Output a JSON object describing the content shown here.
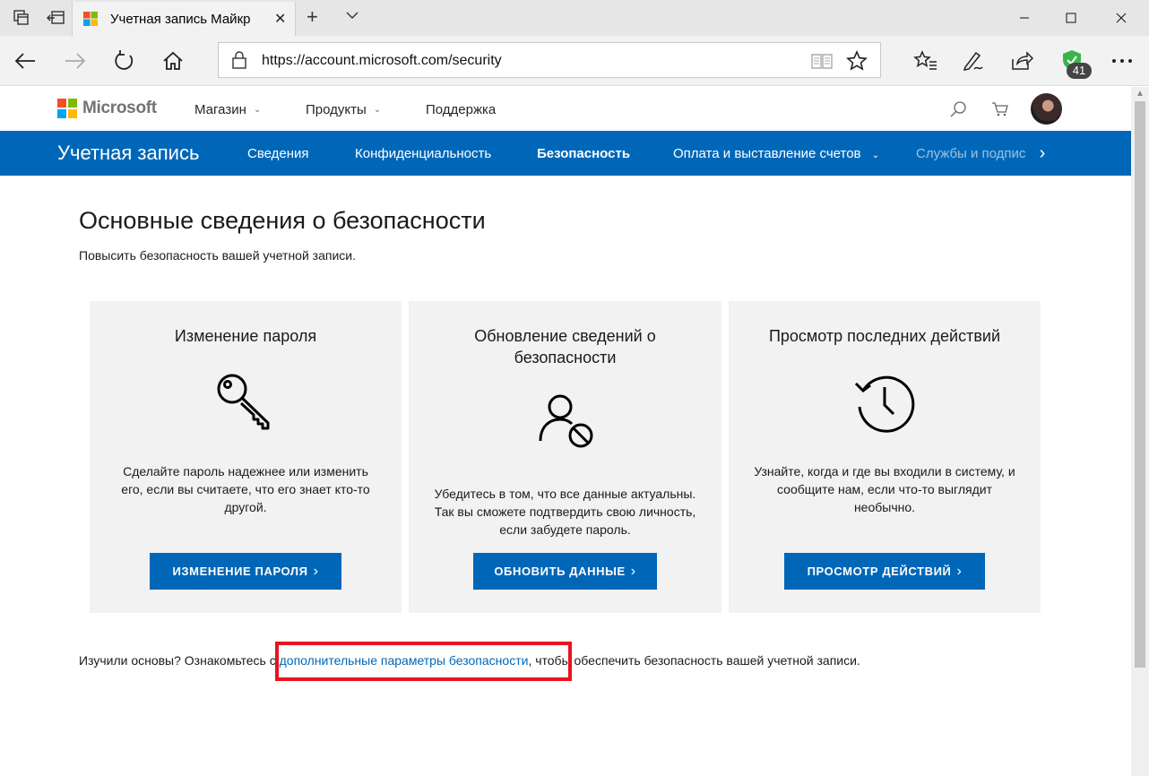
{
  "browser": {
    "tab_title": "Учетная запись Майкр",
    "url": "https://account.microsoft.com/security",
    "extension_badge": "41"
  },
  "header": {
    "brand": "Microsoft",
    "menu": [
      {
        "label": "Магазин",
        "has_dropdown": true
      },
      {
        "label": "Продукты",
        "has_dropdown": true
      },
      {
        "label": "Поддержка",
        "has_dropdown": false
      }
    ]
  },
  "account_nav": {
    "title": "Учетная запись",
    "items": [
      {
        "label": "Сведения",
        "active": false
      },
      {
        "label": "Конфиденциальность",
        "active": false
      },
      {
        "label": "Безопасность",
        "active": true
      },
      {
        "label": "Оплата и выставление счетов",
        "active": false,
        "has_dropdown": true
      },
      {
        "label": "Службы и подпис",
        "active": false
      }
    ]
  },
  "main": {
    "title": "Основные сведения о безопасности",
    "subtitle": "Повысить безопасность вашей учетной записи.",
    "cards": [
      {
        "title": "Изменение пароля",
        "icon": "key-icon",
        "text": "Сделайте пароль надежнее или изменить его, если вы считаете, что его знает кто-то другой.",
        "button": "ИЗМЕНЕНИЕ ПАРОЛЯ"
      },
      {
        "title": "Обновление сведений о безопасности",
        "icon": "user-blocked-icon",
        "text": "Убедитесь в том, что все данные актуальны. Так вы сможете подтвердить свою личность, если забудете пароль.",
        "button": "ОБНОВИТЬ ДАННЫЕ"
      },
      {
        "title": "Просмотр последних действий",
        "icon": "history-clock-icon",
        "text": "Узнайте, когда и где вы входили в систему, и сообщите нам, если что-то выглядит необычно.",
        "button": "ПРОСМОТР ДЕЙСТВИЙ"
      }
    ],
    "footer": {
      "before": "Изучили основы? Ознакомьтесь с ",
      "link": "дополнительные параметры безопасности",
      "after": ", чтобы обеспечить безопасность вашей учетной записи."
    }
  },
  "colors": {
    "accent": "#0067b8",
    "highlight_border": "#e8131f",
    "card_bg": "#f2f2f2"
  }
}
